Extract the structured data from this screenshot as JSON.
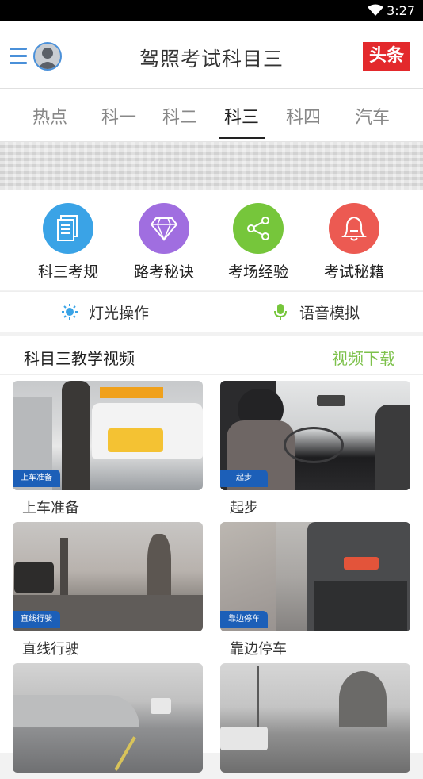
{
  "status_bar": {
    "time": "3:27"
  },
  "header": {
    "title": "驾照考试科目三",
    "brand_badge": "头条"
  },
  "tabs": [
    {
      "label": "热点"
    },
    {
      "label": "科一"
    },
    {
      "label": "科二"
    },
    {
      "label": "科三",
      "active": true
    },
    {
      "label": "科四"
    },
    {
      "label": "汽车"
    }
  ],
  "quick_actions": [
    {
      "label": "科三考规",
      "icon": "document-icon",
      "color": "#3aa3e6"
    },
    {
      "label": "路考秘诀",
      "icon": "diamond-icon",
      "color": "#a06ee0"
    },
    {
      "label": "考场经验",
      "icon": "share-icon",
      "color": "#76c63b"
    },
    {
      "label": "考试秘籍",
      "icon": "bell-icon",
      "color": "#ec5a52"
    }
  ],
  "sub_nav": [
    {
      "label": "灯光操作",
      "icon": "sun-icon",
      "color": "#3aa3e6"
    },
    {
      "label": "语音模拟",
      "icon": "microphone-icon",
      "color": "#76c63b"
    }
  ],
  "video_section": {
    "title": "科目三教学视频",
    "link": "视频下载",
    "videos": [
      {
        "label": "上车准备",
        "tag": "上车准备"
      },
      {
        "label": "起步",
        "tag": "起步"
      },
      {
        "label": "直线行驶",
        "tag": "直线行驶"
      },
      {
        "label": "靠边停车",
        "tag": "靠边停车"
      },
      {
        "label": "",
        "tag": ""
      },
      {
        "label": "",
        "tag": ""
      }
    ]
  },
  "colors": {
    "accent_green": "#7dc14b",
    "accent_blue": "#4a90d9",
    "brand_red": "#e3292c"
  }
}
